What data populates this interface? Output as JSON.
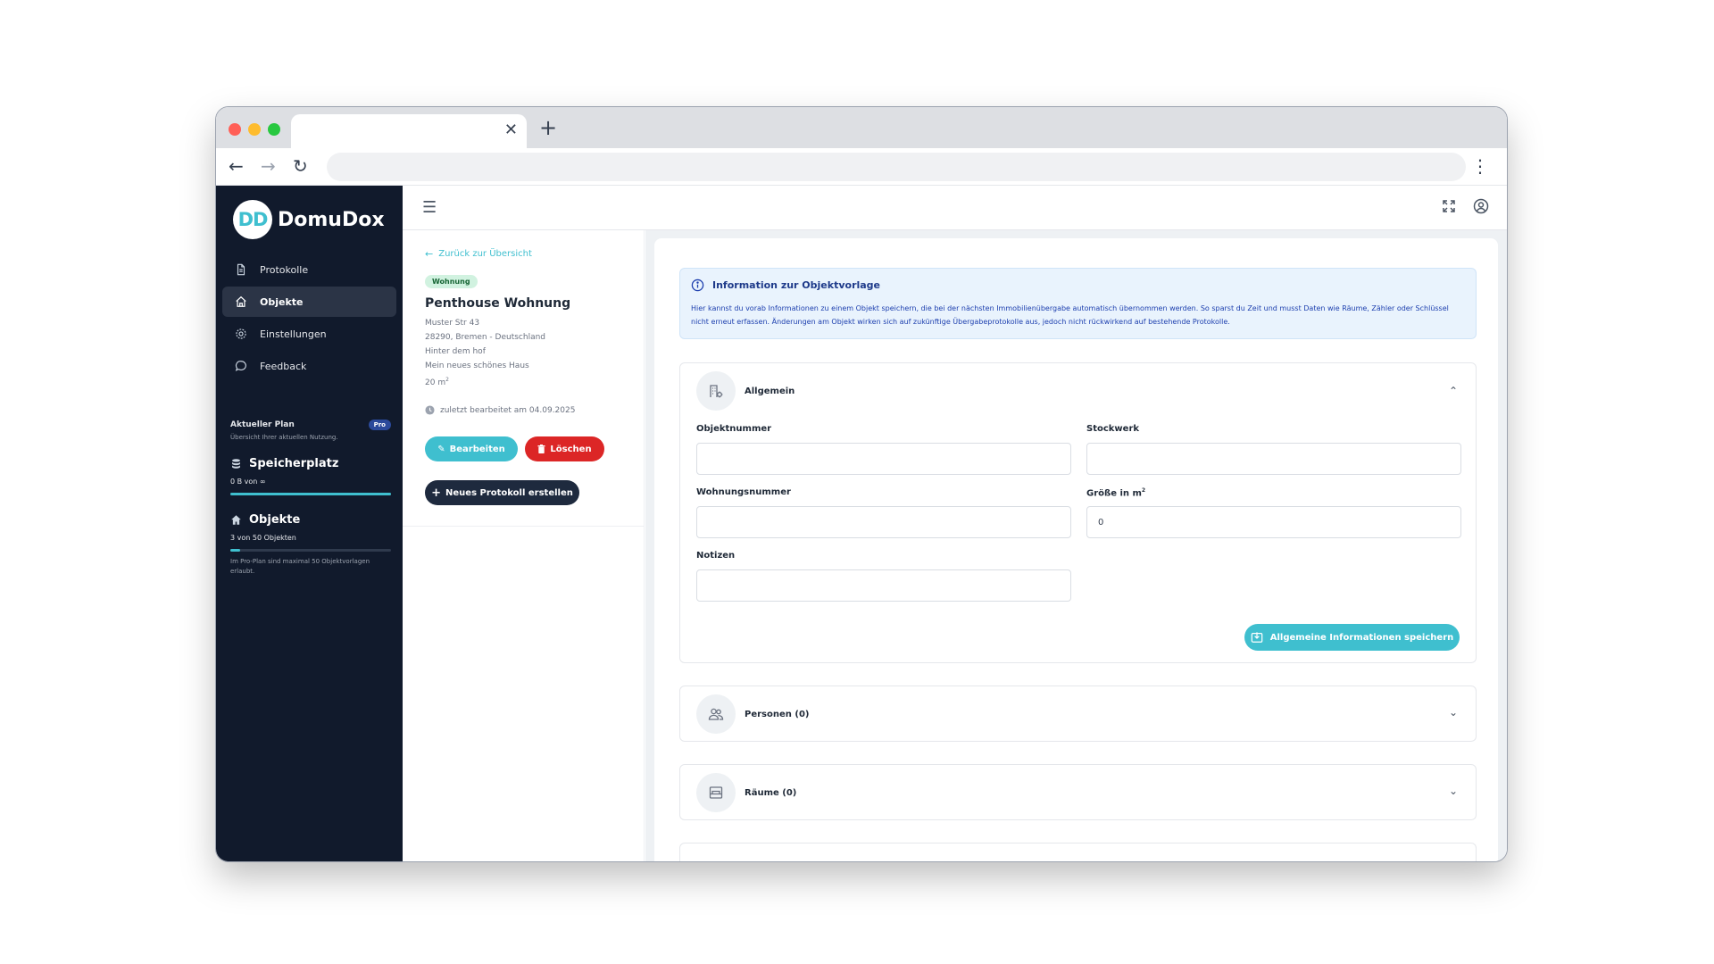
{
  "browser": {
    "new_tab": "+",
    "close": "✕"
  },
  "brand": {
    "mark": "DD",
    "name": "DomuDox"
  },
  "sidebar": {
    "items": [
      {
        "label": "Protokolle",
        "icon": "document-icon"
      },
      {
        "label": "Objekte",
        "icon": "home-icon",
        "active": true
      },
      {
        "label": "Einstellungen",
        "icon": "gear-icon"
      },
      {
        "label": "Feedback",
        "icon": "chat-icon"
      }
    ],
    "plan": {
      "title": "Aktueller Plan",
      "badge": "Pro",
      "subtitle": "Übersicht Ihrer aktuellen Nutzung.",
      "storage_title": "Speicherplatz",
      "storage_value": "0 B von ∞",
      "storage_fill": 1.0,
      "objects_title": "Objekte",
      "objects_value": "3 von 50 Objekten",
      "objects_fill": 0.06,
      "objects_note": "Im Pro-Plan sind maximal 50 Objektvorlagen erlaubt."
    }
  },
  "detail": {
    "back": "Zurück zur Übersicht",
    "badge": "Wohnung",
    "title": "Penthouse Wohnung",
    "address_lines": [
      "Muster Str 43",
      "28290, Bremen - Deutschland",
      "Hinter dem hof",
      "Mein neues schönes Haus"
    ],
    "size": "20 m",
    "size_sup": "2",
    "edited": "zuletzt bearbeitet am 04.09.2025",
    "edit_label": "Bearbeiten",
    "delete_label": "Löschen",
    "new_protocol_label": "Neues Protokoll erstellen"
  },
  "info": {
    "title": "Information zur Objektvorlage",
    "text": "Hier kannst du vorab Informationen zu einem Objekt speichern, die bei der nächsten Immobilienübergabe automatisch übernommen werden. So sparst du Zeit und musst Daten wie Räume, Zähler oder Schlüssel nicht erneut erfassen. Änderungen am Objekt wirken sich auf zukünftige Übergabeprotokolle aus, jedoch nicht rückwirkend auf bestehende Protokolle."
  },
  "general": {
    "title": "Allgemein",
    "fields": {
      "objektnummer": {
        "label": "Objektnummer",
        "value": ""
      },
      "stockwerk": {
        "label": "Stockwerk",
        "value": ""
      },
      "wohnungsnummer": {
        "label": "Wohnungsnummer",
        "value": ""
      },
      "groesse": {
        "label": "Größe in m",
        "label_sup": "2",
        "value": "0"
      },
      "notizen": {
        "label": "Notizen",
        "value": ""
      }
    },
    "save_label": "Allgemeine Informationen speichern"
  },
  "sections": {
    "personen": "Personen (0)",
    "raeume": "Räume (0)"
  }
}
